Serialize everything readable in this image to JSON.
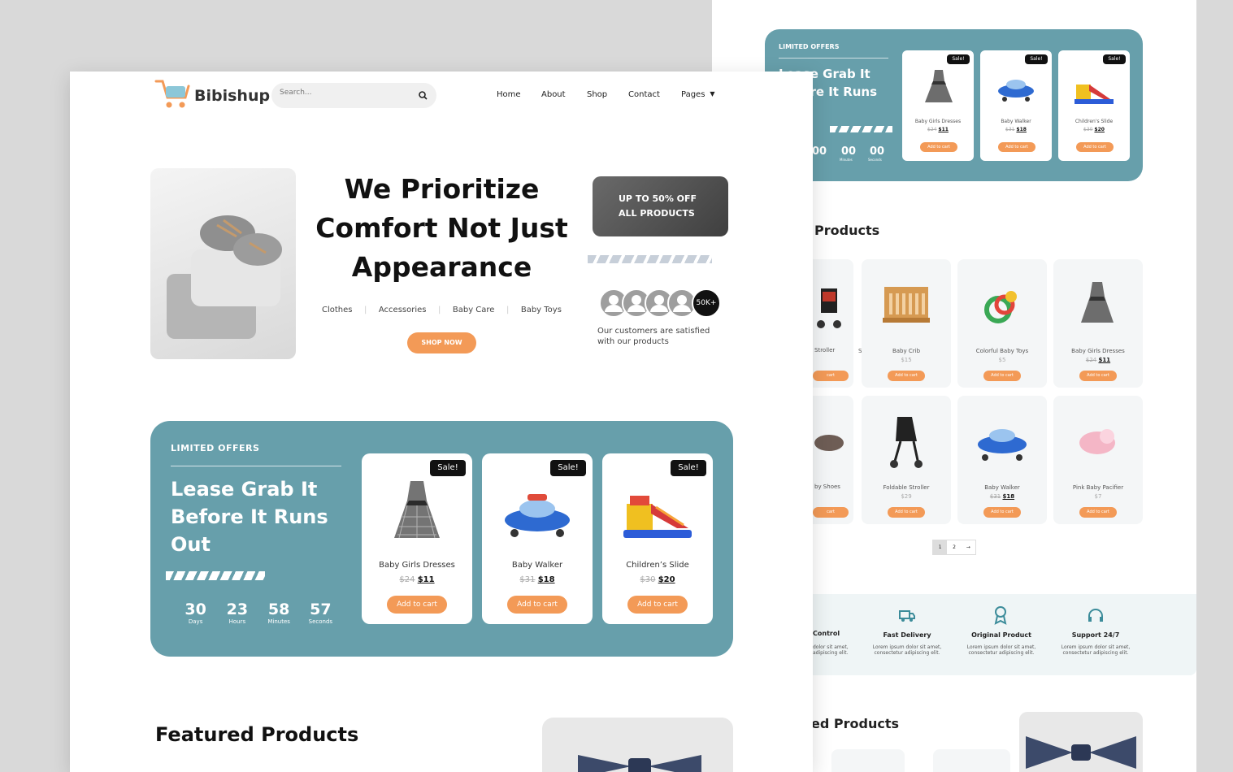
{
  "brand": {
    "name": "Bibishup"
  },
  "search": {
    "placeholder": "Search..."
  },
  "nav": {
    "items": [
      "Home",
      "About",
      "Shop",
      "Contact",
      "Pages"
    ]
  },
  "hero": {
    "title_lines": [
      "We Prioritize",
      "Comfort Not Just",
      "Appearance"
    ],
    "categories": [
      "Clothes",
      "Accessories",
      "Baby Care",
      "Baby Toys"
    ],
    "shop_button": "SHOP NOW",
    "promo": "UP TO 50% OFF ALL PRODUCTS",
    "customers_badge": "50K+",
    "customers_text": "Our customers are satisfied with our products"
  },
  "offers": {
    "label": "LIMITED OFFERS",
    "title_lines": [
      "Lease Grab It",
      "Before It Runs",
      "Out"
    ],
    "countdown": [
      {
        "value": "30",
        "unit": "Days"
      },
      {
        "value": "23",
        "unit": "Hours"
      },
      {
        "value": "58",
        "unit": "Minutes"
      },
      {
        "value": "57",
        "unit": "Seconds"
      }
    ],
    "products": [
      {
        "name": "Baby Girls Dresses",
        "old": "$24",
        "price": "$11",
        "sale": "Sale!",
        "cta": "Add to cart",
        "icon": "dress-icon"
      },
      {
        "name": "Baby Walker",
        "old": "$31",
        "price": "$18",
        "sale": "Sale!",
        "cta": "Add to cart",
        "icon": "walker-icon"
      },
      {
        "name": "Children’s Slide",
        "old": "$30",
        "price": "$20",
        "sale": "Sale!",
        "cta": "Add to cart",
        "icon": "slide-icon"
      }
    ]
  },
  "featured": {
    "title": "Featured Products"
  },
  "back": {
    "offer_label": "LIMITED OFFERS",
    "offer_title_lines": [
      "Lease Grab It",
      "Before It Runs"
    ],
    "countdown": [
      "00",
      "00",
      "00"
    ],
    "countdown_units": [
      "Hours",
      "Minutes",
      "Seconds"
    ],
    "offer_products": [
      {
        "name": "Baby Girls Dresses",
        "old": "$24",
        "price": "$11",
        "sale": "Sale!",
        "cta": "Add to cart"
      },
      {
        "name": "Baby Walker",
        "old": "$31",
        "price": "$18",
        "sale": "Sale!",
        "cta": "Add to cart"
      },
      {
        "name": "Children's Slide",
        "old": "$30",
        "price": "$20",
        "sale": "Sale!",
        "cta": "Add to cart"
      }
    ],
    "products_title": "Products",
    "grid": [
      {
        "name": "Stroller",
        "price": "",
        "cta": "cart"
      },
      {
        "name": "Baby Crib",
        "price": "$15",
        "cta": "Add to cart"
      },
      {
        "name": "Colorful Baby Toys",
        "price": "$5",
        "cta": "Add to cart"
      },
      {
        "name": "Baby Girls Dresses",
        "old": "$24",
        "price": "$11",
        "cta": "Add to cart"
      },
      {
        "name": "by Shoes",
        "price": "",
        "cta": "cart"
      },
      {
        "name": "Foldable Stroller",
        "price": "$29",
        "cta": "Add to cart"
      },
      {
        "name": "Baby Walker",
        "old": "$31",
        "price": "$18",
        "cta": "Add to cart"
      },
      {
        "name": "Pink Baby Pacifier",
        "price": "$7",
        "cta": "Add to cart"
      }
    ],
    "pagination": [
      "1",
      "2",
      "→"
    ],
    "features": [
      {
        "title": "Control",
        "text": "dolor sit amet, adipiscing elit."
      },
      {
        "title": "Fast Delivery",
        "text": "Lorem ipsum dolor sit amet, consectetur adipiscing elit."
      },
      {
        "title": "Original Product",
        "text": "Lorem ipsum dolor sit amet, consectetur adipiscing elit."
      },
      {
        "title": "Support 24/7",
        "text": "Lorem ipsum dolor sit amet, consectetur adipiscing elit."
      }
    ],
    "featured_title": "ed Products"
  },
  "colors": {
    "teal": "#679fab",
    "orange": "#f39a57",
    "dark": "#111111"
  }
}
